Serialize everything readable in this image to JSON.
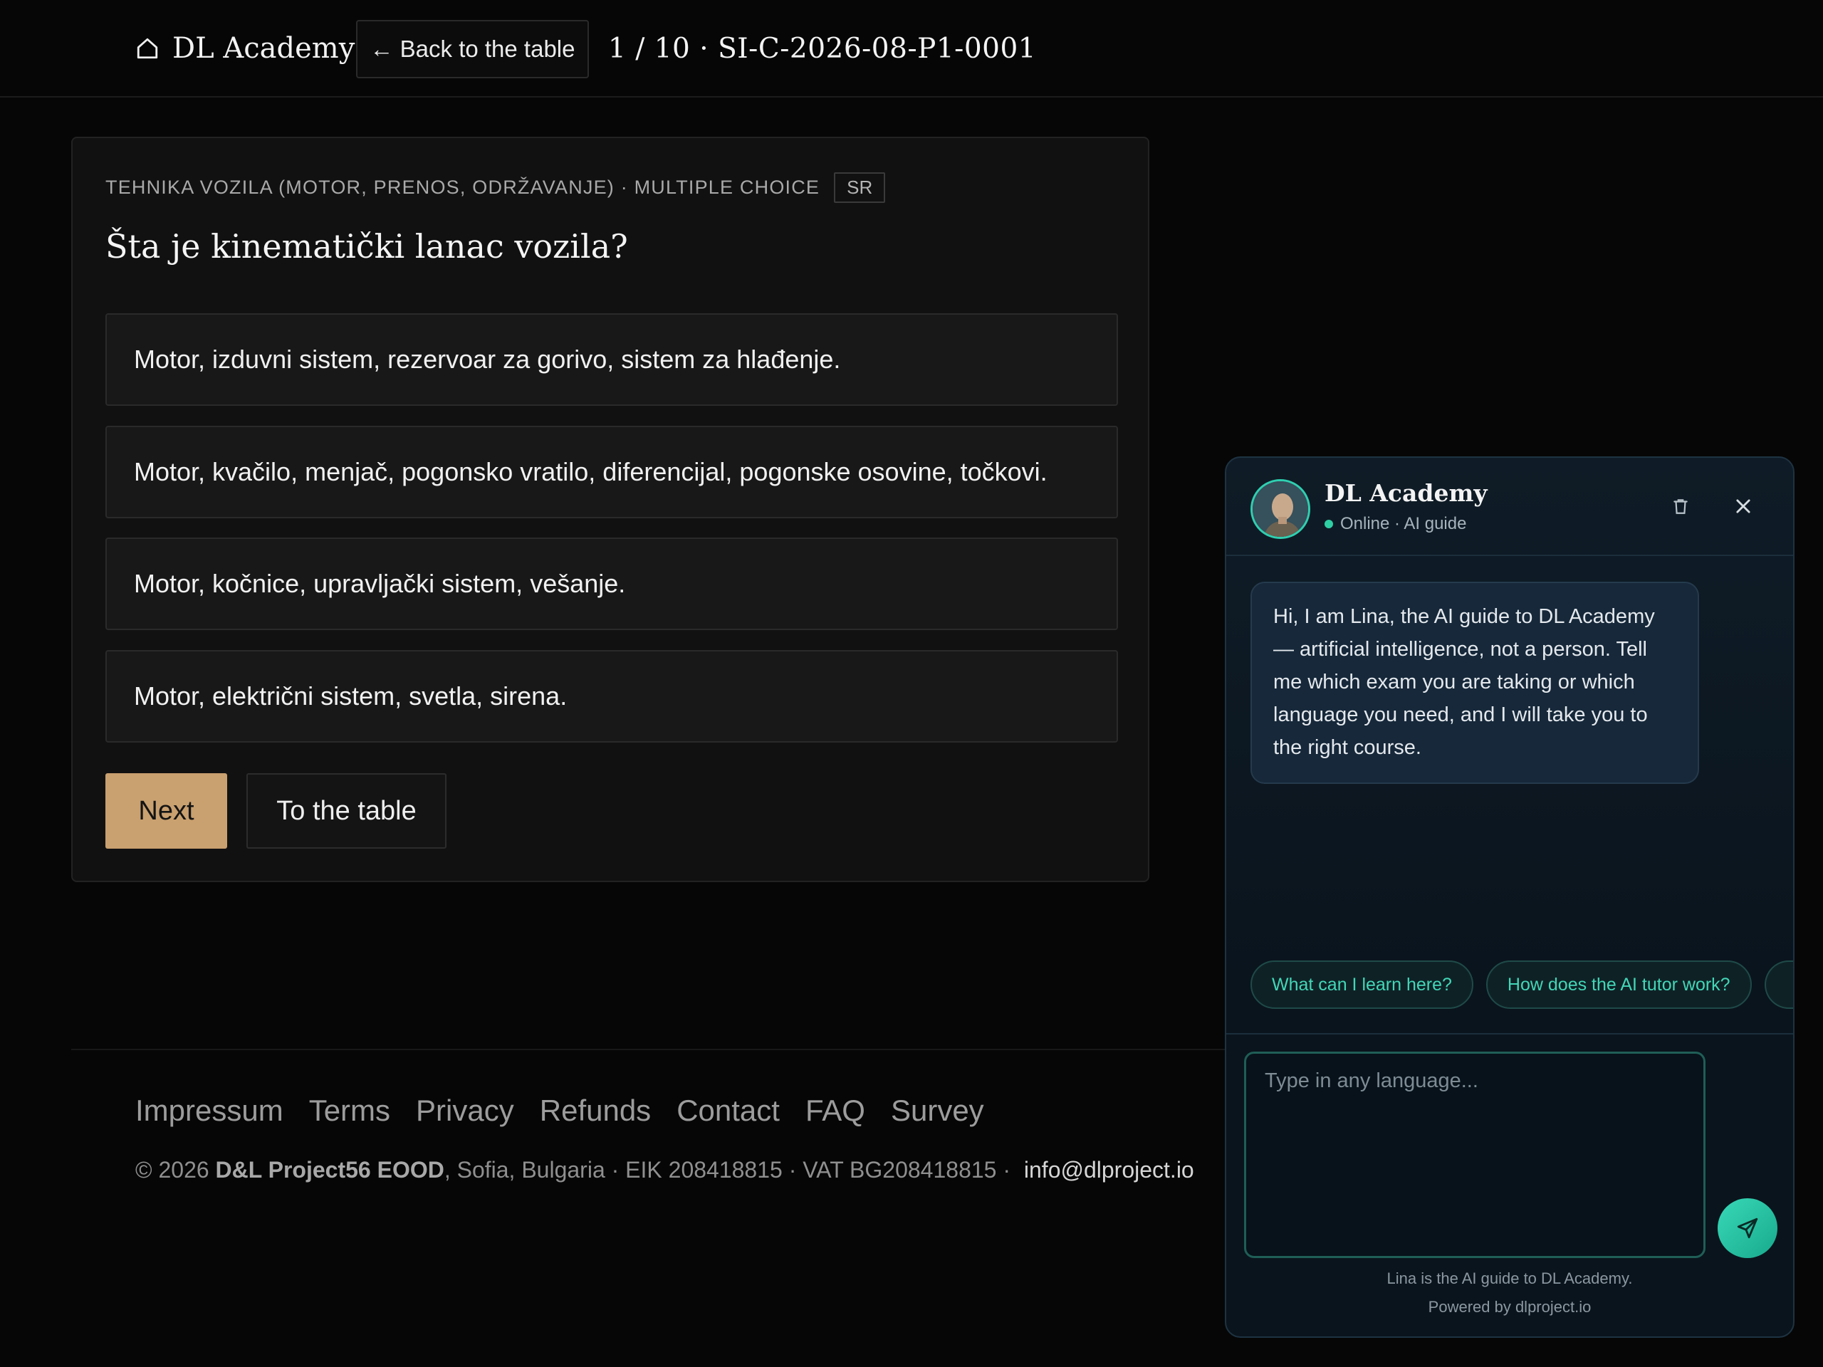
{
  "header": {
    "brand_name": "DL Academy",
    "back_label": "← Back to the table",
    "breadcrumb": "1 / 10 · SI-C-2026-08-P1-0001"
  },
  "question": {
    "meta": "TEHNIKA VOZILA (MOTOR, PRENOS, ODRŽAVANJE) · MULTIPLE CHOICE",
    "lang_badge": "SR",
    "text": "Šta je kinematički lanac vozila?",
    "options": [
      "Motor, izduvni sistem, rezervoar za gorivo, sistem za hlađenje.",
      "Motor, kvačilo, menjač, pogonsko vratilo, diferencijal, pogonske osovine, točkovi.",
      "Motor, kočnice, upravljački sistem, vešanje.",
      "Motor, električni sistem, svetla, sirena."
    ],
    "next_label": "Next",
    "table_label": "To the table"
  },
  "footer": {
    "links": [
      "Impressum",
      "Terms",
      "Privacy",
      "Refunds",
      "Contact",
      "FAQ",
      "Survey"
    ],
    "copyright_prefix": "© 2026 ",
    "company": "D&L Project56 EOOD",
    "copyright_suffix": ", Sofia, Bulgaria · EIK 208418815 · VAT BG208418815 · ",
    "email": "info@dlproject.io"
  },
  "chat": {
    "title": "DL Academy",
    "status": "Online · AI guide",
    "message": "Hi, I am Lina, the AI guide to DL Academy — artificial intelligence, not a person. Tell me which exam you are taking or which language you need, and I will take you to the right course.",
    "suggestions": [
      "What can I learn here?",
      "How does the AI tutor work?"
    ],
    "input_placeholder": "Type in any language...",
    "note": "Lina is the AI guide to DL Academy.",
    "powered_by": "Powered by dlproject.io"
  },
  "colors": {
    "background": "#060606",
    "accent_button": "#c9a06f",
    "chat_accent": "#2fcfb0"
  },
  "icons": {
    "brand": "home-icon",
    "trash": "trash-icon",
    "close": "close-icon",
    "send": "send-icon",
    "status": "online-dot-icon"
  }
}
